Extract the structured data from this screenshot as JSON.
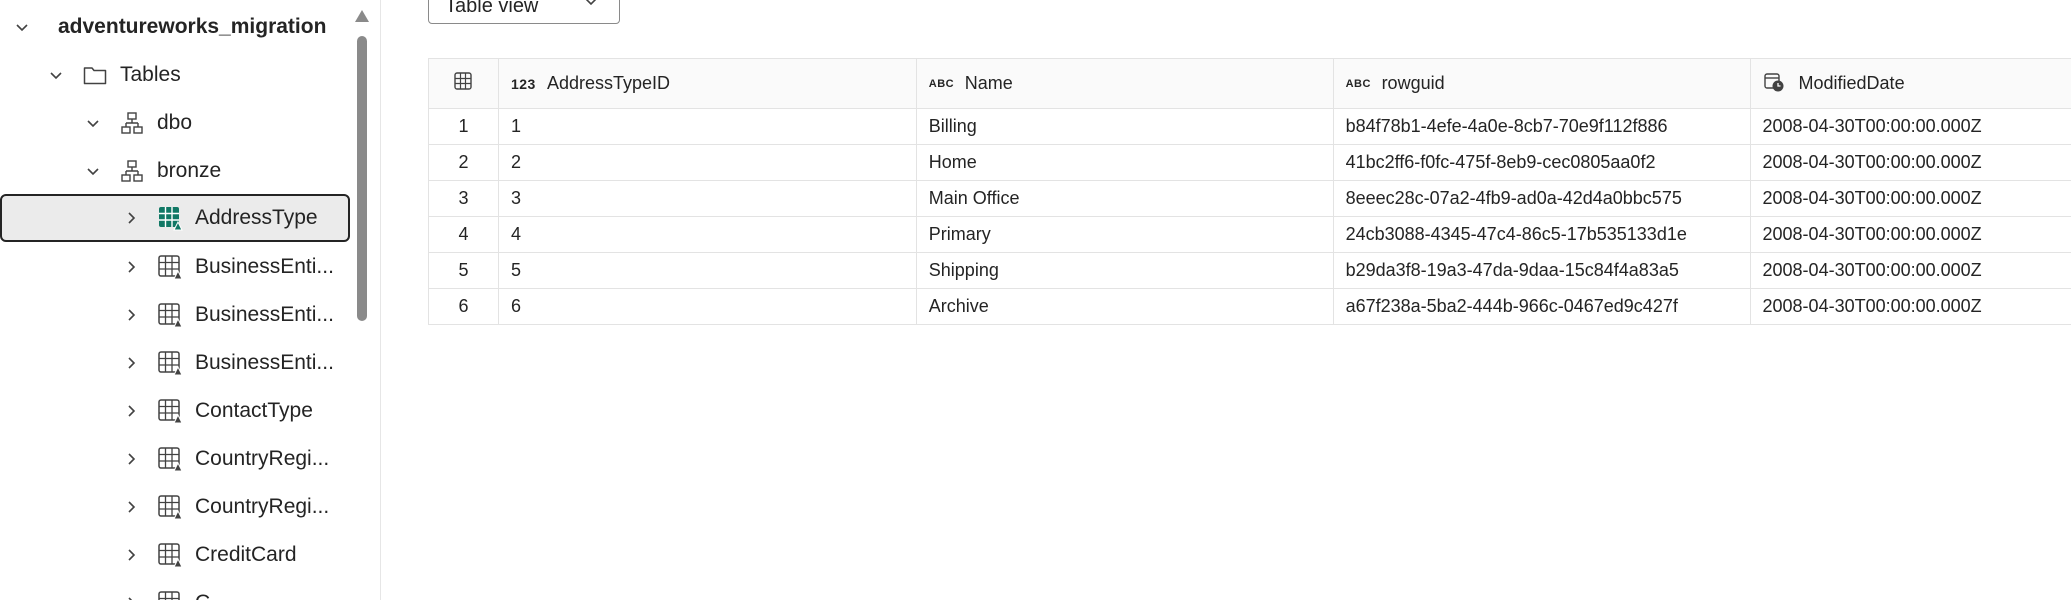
{
  "explorer": {
    "root": {
      "label": "adventureworks_migration"
    },
    "tables_folder": {
      "label": "Tables"
    },
    "schemas": [
      {
        "label": "dbo"
      },
      {
        "label": "bronze"
      }
    ],
    "items": [
      {
        "label": "AddressType",
        "selected": true
      },
      {
        "label": "BusinessEnti..."
      },
      {
        "label": "BusinessEnti..."
      },
      {
        "label": "BusinessEnti..."
      },
      {
        "label": "ContactType"
      },
      {
        "label": "CountryRegi..."
      },
      {
        "label": "CountryRegi..."
      },
      {
        "label": "CreditCard"
      },
      {
        "label": "C..."
      }
    ]
  },
  "view_selector": {
    "value": "Table view"
  },
  "grid": {
    "columns": [
      {
        "label": "AddressTypeID",
        "type_icon": "123",
        "type": "integer"
      },
      {
        "label": "Name",
        "type_icon": "ABC",
        "type": "string"
      },
      {
        "label": "rowguid",
        "type_icon": "ABC",
        "type": "string"
      },
      {
        "label": "ModifiedDate",
        "type_icon": "calendar-clock-icon",
        "type": "datetime"
      }
    ],
    "rows": [
      {
        "index": "1",
        "cells": [
          "1",
          "Billing",
          "b84f78b1-4efe-4a0e-8cb7-70e9f112f886",
          "2008-04-30T00:00:00.000Z"
        ]
      },
      {
        "index": "2",
        "cells": [
          "2",
          "Home",
          "41bc2ff6-f0fc-475f-8eb9-cec0805aa0f2",
          "2008-04-30T00:00:00.000Z"
        ]
      },
      {
        "index": "3",
        "cells": [
          "3",
          "Main Office",
          "8eeec28c-07a2-4fb9-ad0a-42d4a0bbc575",
          "2008-04-30T00:00:00.000Z"
        ]
      },
      {
        "index": "4",
        "cells": [
          "4",
          "Primary",
          "24cb3088-4345-47c4-86c5-17b535133d1e",
          "2008-04-30T00:00:00.000Z"
        ]
      },
      {
        "index": "5",
        "cells": [
          "5",
          "Shipping",
          "b29da3f8-19a3-47da-9daa-15c84f4a83a5",
          "2008-04-30T00:00:00.000Z"
        ]
      },
      {
        "index": "6",
        "cells": [
          "6",
          "Archive",
          "a67f238a-5ba2-444b-966c-0467ed9c427f",
          "2008-04-30T00:00:00.000Z"
        ]
      }
    ]
  },
  "colors": {
    "accent_table_icon": "#117865",
    "selected_row_bg": "#ebebeb",
    "text": "#242424",
    "border": "#e3e3e3"
  }
}
